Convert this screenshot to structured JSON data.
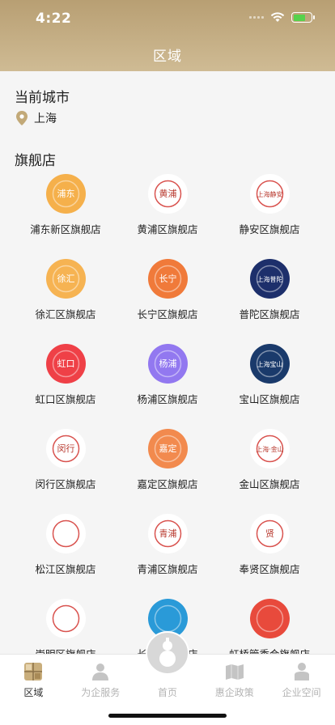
{
  "status": {
    "time": "4:22"
  },
  "nav": {
    "title": "区域"
  },
  "current_city": {
    "heading": "当前城市",
    "city": "上海"
  },
  "flagship": {
    "heading": "旗舰店",
    "stores": [
      {
        "name": "浦东新区旗舰店",
        "logo_color": "#f5b04b",
        "logo_text": "浦东",
        "icon": "pudong-logo-icon"
      },
      {
        "name": "黄浦区旗舰店",
        "logo_color": "#ffffff",
        "logo_text": "黄浦",
        "icon": "huangpu-logo-icon"
      },
      {
        "name": "静安区旗舰店",
        "logo_color": "#ffffff",
        "logo_text": "上海静安",
        "icon": "jingan-logo-icon"
      },
      {
        "name": "徐汇区旗舰店",
        "logo_color": "#f6b352",
        "logo_text": "徐汇",
        "icon": "xuhui-logo-icon"
      },
      {
        "name": "长宁区旗舰店",
        "logo_color": "#f07a3a",
        "logo_text": "长宁",
        "icon": "changning-logo-icon"
      },
      {
        "name": "普陀区旗舰店",
        "logo_color": "#1d2f6b",
        "logo_text": "上海普陀",
        "icon": "putuo-logo-icon"
      },
      {
        "name": "虹口区旗舰店",
        "logo_color": "#ef4047",
        "logo_text": "虹口",
        "icon": "hongkou-logo-icon"
      },
      {
        "name": "杨浦区旗舰店",
        "logo_color": "#9278f0",
        "logo_text": "杨浦",
        "icon": "yangpu-logo-icon"
      },
      {
        "name": "宝山区旗舰店",
        "logo_color": "#1a3a6b",
        "logo_text": "上海宝山",
        "icon": "baoshan-logo-icon"
      },
      {
        "name": "闵行区旗舰店",
        "logo_color": "#ffffff",
        "logo_text": "闵行",
        "icon": "minhang-logo-icon"
      },
      {
        "name": "嘉定区旗舰店",
        "logo_color": "#f28a4e",
        "logo_text": "嘉定",
        "icon": "jiading-logo-icon"
      },
      {
        "name": "金山区旗舰店",
        "logo_color": "#ffffff",
        "logo_text": "上海·金山",
        "icon": "jinshan-logo-icon"
      },
      {
        "name": "松江区旗舰店",
        "logo_color": "#ffffff",
        "logo_text": "",
        "icon": "songjiang-logo-icon"
      },
      {
        "name": "青浦区旗舰店",
        "logo_color": "#ffffff",
        "logo_text": "青浦",
        "icon": "qingpu-logo-icon"
      },
      {
        "name": "奉贤区旗舰店",
        "logo_color": "#ffffff",
        "logo_text": "贤",
        "icon": "fengxian-logo-icon"
      },
      {
        "name": "崇明区旗舰店",
        "logo_color": "#ffffff",
        "logo_text": "",
        "icon": "chongming-logo-icon"
      },
      {
        "name": "长三角旗舰店",
        "logo_color": "#2a9ad8",
        "logo_text": "",
        "icon": "changsanjiao-logo-icon"
      },
      {
        "name": "虹桥管委会旗舰店",
        "logo_color": "#e84a3c",
        "logo_text": "",
        "icon": "hongqiao-logo-icon"
      }
    ]
  },
  "tabbar": {
    "tabs": [
      {
        "label": "区域",
        "active": true
      },
      {
        "label": "为企服务",
        "active": false
      },
      {
        "label": "首页",
        "active": false
      },
      {
        "label": "惠企政策",
        "active": false
      },
      {
        "label": "企业空间",
        "active": false
      }
    ]
  }
}
